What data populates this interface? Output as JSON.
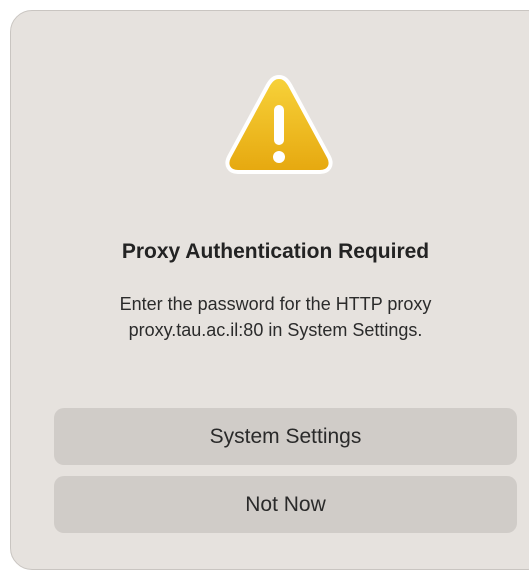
{
  "dialog": {
    "icon": "warning-triangle-icon",
    "title": "Proxy Authentication Required",
    "message_line1": "Enter the password for the HTTP proxy",
    "message_line2": "proxy.tau.ac.il:80 in System Settings.",
    "buttons": {
      "primary_label": "System Settings",
      "secondary_label": "Not Now"
    },
    "colors": {
      "background": "#e6e2de",
      "button": "#d0ccc8",
      "warning_yellow": "#f2c21a"
    }
  }
}
